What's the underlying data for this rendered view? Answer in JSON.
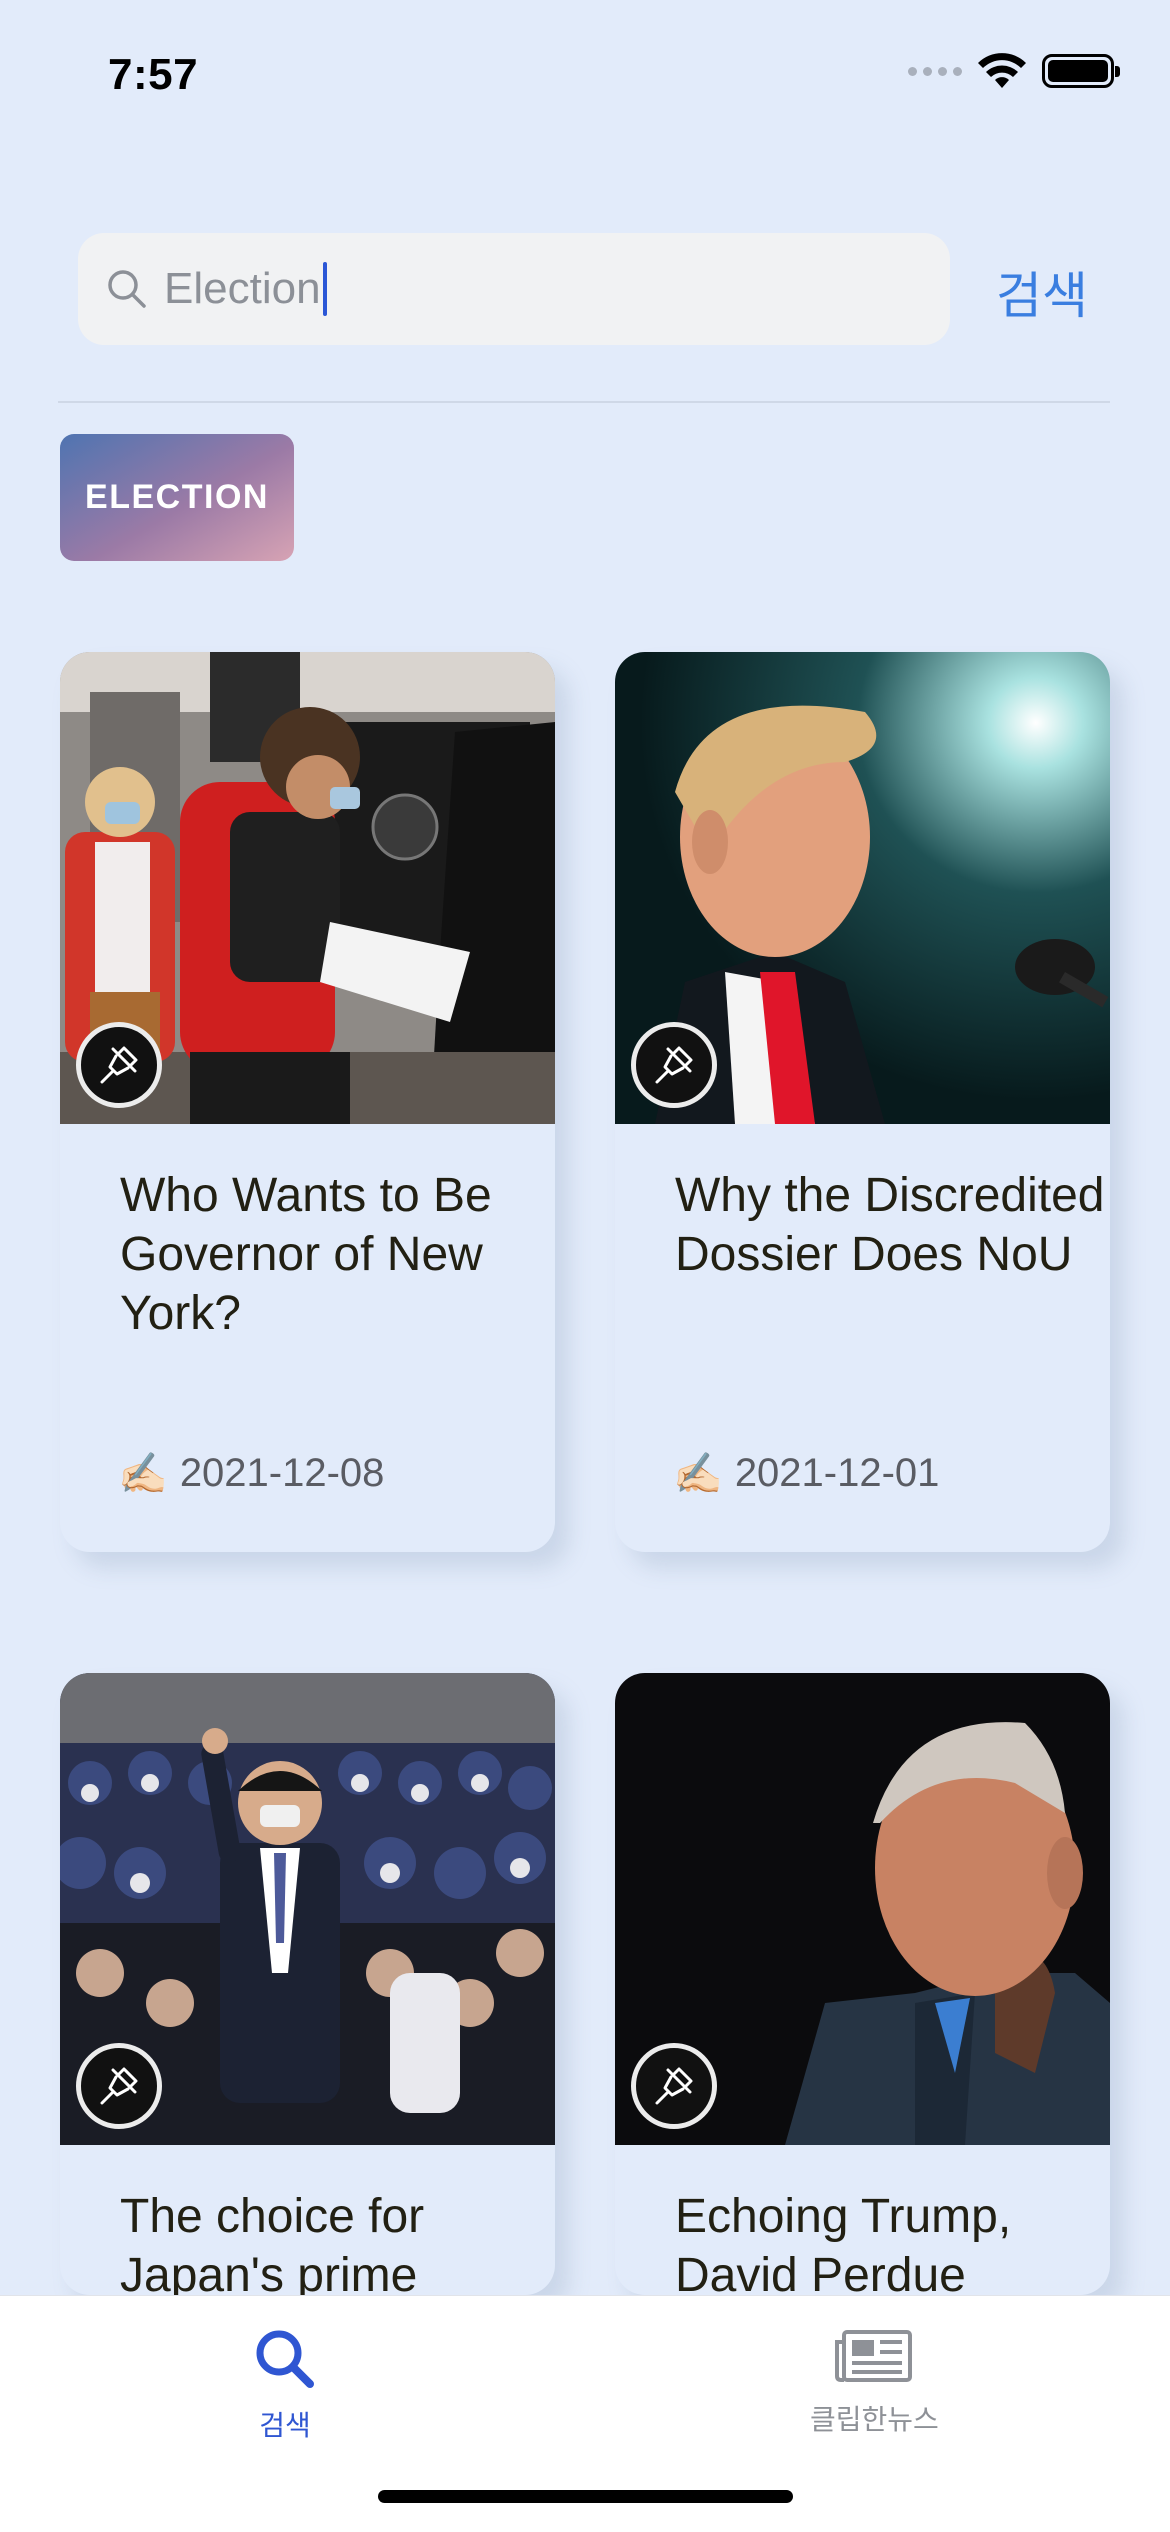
{
  "status": {
    "time": "7:57"
  },
  "search": {
    "query": "Election",
    "button_label": "검색"
  },
  "tag": {
    "label": "ELECTION"
  },
  "cards": [
    {
      "title": "Who Wants to Be Governor of New York?",
      "date": "2021-12-08",
      "writer_icon": "✍🏻"
    },
    {
      "title": "Why the Discredited Dossier Does NoU",
      "date": "2021-12-01",
      "writer_icon": "✍🏻"
    },
    {
      "title": "The choice for Japan's prime",
      "date": "",
      "writer_icon": ""
    },
    {
      "title": "Echoing Trump, David Perdue",
      "date": "",
      "writer_icon": ""
    }
  ],
  "tabbar": {
    "search_label": "검색",
    "clip_label": "클립한뉴스",
    "active_color": "#2f56d2",
    "inactive_color": "#8e9197"
  },
  "icons": {
    "search": "search-icon",
    "pin": "pin-icon",
    "newspaper": "newspaper-icon"
  }
}
